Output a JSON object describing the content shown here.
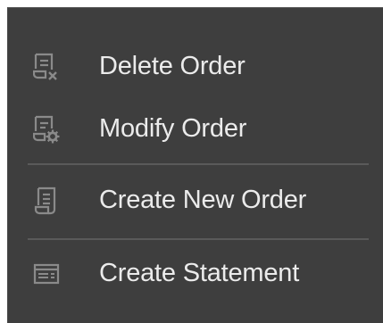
{
  "menu": {
    "items": [
      {
        "label": "Delete Order",
        "icon": "delete-order-icon"
      },
      {
        "label": "Modify Order",
        "icon": "modify-order-icon"
      },
      {
        "label": "Create New Order",
        "icon": "new-order-icon"
      },
      {
        "label": "Create Statement",
        "icon": "statement-icon"
      }
    ]
  },
  "colors": {
    "background": "#3e3e3e",
    "text": "#ebebeb",
    "icon": "#8a8a8a",
    "divider": "#5a5a5a"
  }
}
